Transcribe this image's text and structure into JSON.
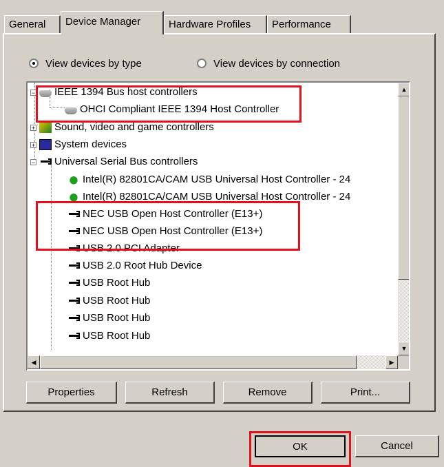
{
  "tabs": [
    {
      "label": "General"
    },
    {
      "label": "Device Manager"
    },
    {
      "label": "Hardware Profiles"
    },
    {
      "label": "Performance"
    }
  ],
  "view": {
    "by_type": "View devices by type",
    "by_connection": "View devices by connection"
  },
  "tree": {
    "ieee_group": "IEEE 1394 Bus host controllers",
    "ohci": "OHCI Compliant IEEE 1394 Host Controller",
    "sound": "Sound, video and game controllers",
    "system": "System devices",
    "usb_group": "Universal Serial Bus controllers",
    "intel1": "Intel(R) 82801CA/CAM USB Universal Host Controller - 24",
    "intel2": "Intel(R) 82801CA/CAM USB Universal Host Controller - 24",
    "nec1": "NEC USB Open Host Controller (E13+)",
    "nec2": "NEC USB Open Host Controller (E13+)",
    "usb20": "USB 2.0 PCI Adapter",
    "usb20hub": "USB 2.0 Root Hub Device",
    "root1": "USB Root Hub",
    "root2": "USB Root Hub",
    "root3": "USB Root Hub",
    "root4": "USB Root Hub"
  },
  "buttons": {
    "properties": "Properties",
    "refresh": "Refresh",
    "remove": "Remove",
    "print": "Print...",
    "ok": "OK",
    "cancel": "Cancel"
  },
  "colors": {
    "highlight": "#e0121b",
    "face": "#d4d0c8"
  }
}
